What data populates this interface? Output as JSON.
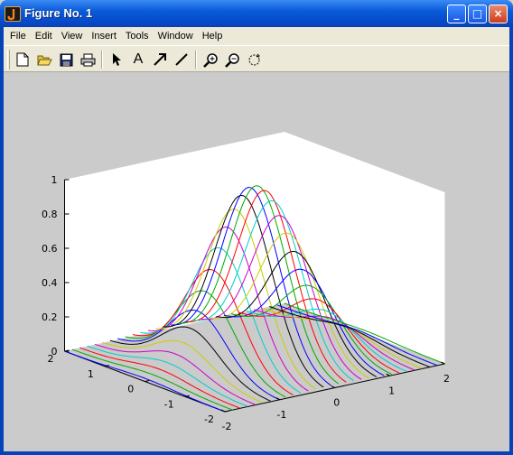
{
  "window": {
    "title": "Figure No. 1"
  },
  "titlebar_buttons": {
    "minimize": "_",
    "maximize": "□",
    "close": "×"
  },
  "menu": [
    "File",
    "Edit",
    "View",
    "Insert",
    "Tools",
    "Window",
    "Help"
  ],
  "toolbar": [
    "new-file-icon",
    "open-folder-icon",
    "save-icon",
    "print-icon",
    "select-arrow-icon",
    "insert-text-icon",
    "insert-arrow-icon",
    "insert-line-icon",
    "zoom-in-icon",
    "zoom-out-icon",
    "rotate-3d-icon"
  ],
  "toolbar_text_tool": "A",
  "chart_data": {
    "type": "surface-contour3",
    "function": "exp(-(x^2 + y^2))",
    "x_range": [
      -2,
      2
    ],
    "y_range": [
      -2,
      2
    ],
    "z_range": [
      0,
      1
    ],
    "z_ticks": [
      "0",
      "0.2",
      "0.4",
      "0.6",
      "0.8",
      "1"
    ],
    "x_ticks": [
      "-2",
      "-1",
      "0",
      "1",
      "2"
    ],
    "y_ticks": [
      "2",
      "1",
      "0",
      "-1",
      "-2"
    ],
    "slice_count": 30,
    "line_colors": [
      "#0000ff",
      "#00aa00",
      "#ff0000",
      "#00cccc",
      "#cc00cc",
      "#cccc00",
      "#000000"
    ],
    "grid": false
  }
}
